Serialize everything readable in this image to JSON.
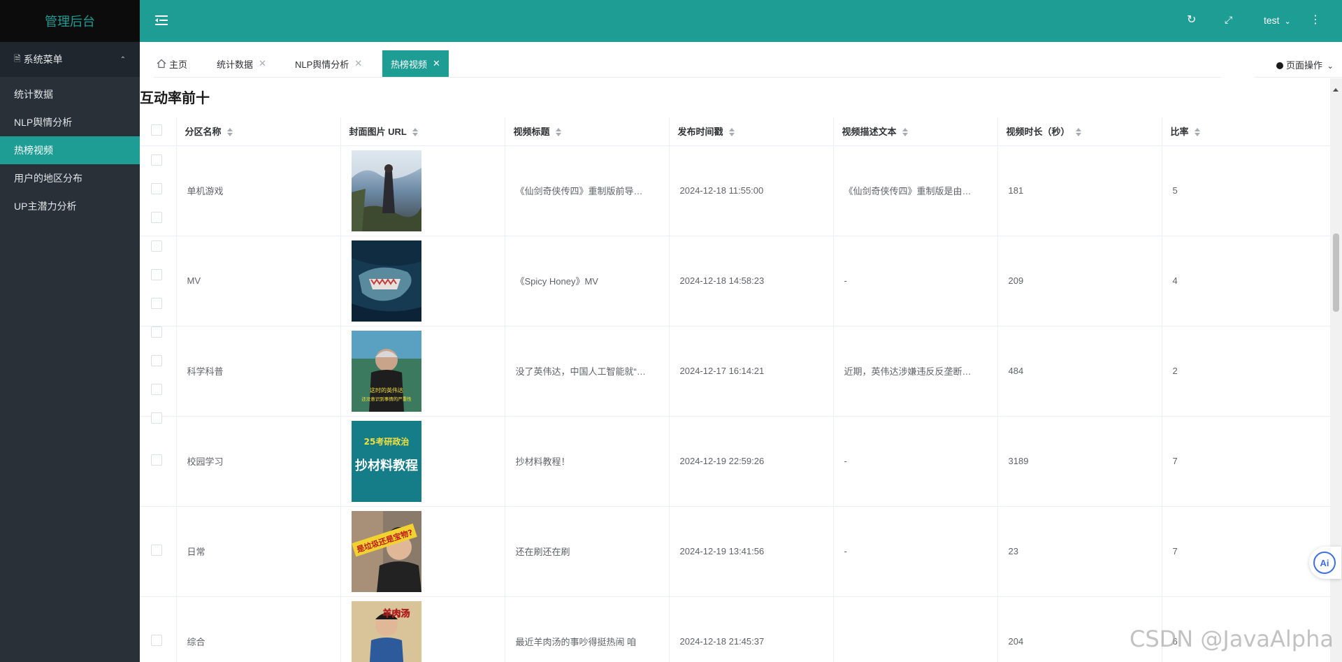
{
  "app": {
    "title": "管理后台"
  },
  "sidebar": {
    "group_label": "系统菜单",
    "items": [
      {
        "label": "统计数据",
        "active": false
      },
      {
        "label": "NLP舆情分析",
        "active": false
      },
      {
        "label": "热榜视频",
        "active": true
      },
      {
        "label": "用户的地区分布",
        "active": false
      },
      {
        "label": "UP主潜力分析",
        "active": false
      }
    ]
  },
  "header": {
    "user": "test",
    "icons": [
      "menu-fold-icon",
      "refresh-icon",
      "fullscreen-icon",
      "more-vertical-icon"
    ]
  },
  "tabs": [
    {
      "label": "主页",
      "closable": false,
      "active": false
    },
    {
      "label": "统计数据",
      "closable": true,
      "active": false
    },
    {
      "label": "NLP舆情分析",
      "closable": true,
      "active": false
    },
    {
      "label": "热榜视频",
      "closable": true,
      "active": true
    }
  ],
  "page_ops": "页面操作",
  "section": {
    "title": "互动率前十"
  },
  "table": {
    "columns": [
      "分区名称",
      "封面图片 URL",
      "视频标题",
      "发布时间戳",
      "视频描述文本",
      "视频时长（秒）",
      "比率"
    ],
    "rows": [
      {
        "category": "单机游戏",
        "title": "《仙剑奇侠传四》重制版前导…",
        "time": "2024-12-18 11:55:00",
        "desc": "《仙剑奇侠传四》重制版是由…",
        "duration": "181",
        "ratio": "5"
      },
      {
        "category": "MV",
        "title": "《Spicy Honey》MV",
        "time": "2024-12-18 14:58:23",
        "desc": "-",
        "duration": "209",
        "ratio": "4"
      },
      {
        "category": "科学科普",
        "title": "没了英伟达，中国人工智能就“…",
        "time": "2024-12-17 16:14:21",
        "desc": "近期，英伟达涉嫌违反反垄断…",
        "duration": "484",
        "ratio": "2"
      },
      {
        "category": "校园学习",
        "title": "抄材料教程！",
        "time": "2024-12-19 22:59:26",
        "desc": "-",
        "duration": "3189",
        "ratio": "7"
      },
      {
        "category": "日常",
        "title": "还在刷还在刷",
        "time": "2024-12-19 13:41:56",
        "desc": "-",
        "duration": "23",
        "ratio": "7"
      },
      {
        "category": "综合",
        "title": "最近羊肉汤的事吵得挺热闹 咱",
        "time": "2024-12-18 21:45:37",
        "desc": "",
        "duration": "204",
        "ratio": "6"
      }
    ],
    "thumb_texts": {
      "row3": [
        "这时的英伟达",
        "还没意识到事情的严重性"
      ],
      "row4": [
        "25考研政治",
        "抄材料教程"
      ],
      "row5": [
        "是垃圾还是宝物?"
      ],
      "row6": [
        "羊肉汤"
      ]
    }
  },
  "ai_button": "Ai",
  "watermark": "CSDN @JavaAlpha"
}
